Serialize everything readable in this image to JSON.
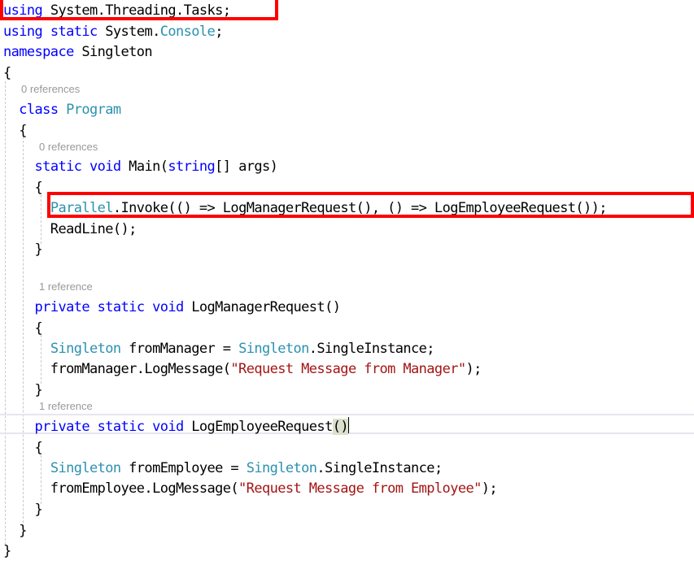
{
  "editor": {
    "lines": [
      {
        "tokens": [
          {
            "t": "using",
            "c": "kw"
          },
          {
            "t": " System.Threading.Tasks;",
            "c": ""
          }
        ]
      },
      {
        "tokens": [
          {
            "t": "using",
            "c": "kw"
          },
          {
            "t": " ",
            "c": ""
          },
          {
            "t": "static",
            "c": "kw"
          },
          {
            "t": " System.",
            "c": ""
          },
          {
            "t": "Console",
            "c": "ty"
          },
          {
            "t": ";",
            "c": ""
          }
        ]
      },
      {
        "tokens": [
          {
            "t": "namespace",
            "c": "kw"
          },
          {
            "t": " Singleton",
            "c": ""
          }
        ]
      },
      {
        "tokens": [
          {
            "t": "{",
            "c": ""
          }
        ]
      },
      {
        "tokens": [
          {
            "t": "  ",
            "c": ""
          },
          {
            "t": "class",
            "c": "kw"
          },
          {
            "t": " ",
            "c": ""
          },
          {
            "t": "Program",
            "c": "ty"
          }
        ]
      },
      {
        "tokens": [
          {
            "t": "  {",
            "c": ""
          }
        ]
      },
      {
        "tokens": [
          {
            "t": "    ",
            "c": ""
          },
          {
            "t": "static",
            "c": "kw"
          },
          {
            "t": " ",
            "c": ""
          },
          {
            "t": "void",
            "c": "kw"
          },
          {
            "t": " Main(",
            "c": ""
          },
          {
            "t": "string",
            "c": "kw"
          },
          {
            "t": "[] args)",
            "c": ""
          }
        ]
      },
      {
        "tokens": [
          {
            "t": "    {",
            "c": ""
          }
        ]
      },
      {
        "tokens": [
          {
            "t": "      ",
            "c": ""
          },
          {
            "t": "Parallel",
            "c": "ty"
          },
          {
            "t": ".Invoke(() => LogManagerRequest(), () => LogEmployeeRequest());",
            "c": ""
          }
        ]
      },
      {
        "tokens": [
          {
            "t": "      ReadLine();",
            "c": ""
          }
        ]
      },
      {
        "tokens": [
          {
            "t": "    }",
            "c": ""
          }
        ]
      },
      {
        "tokens": [
          {
            "t": "    ",
            "c": ""
          },
          {
            "t": "private",
            "c": "kw"
          },
          {
            "t": " ",
            "c": ""
          },
          {
            "t": "static",
            "c": "kw"
          },
          {
            "t": " ",
            "c": ""
          },
          {
            "t": "void",
            "c": "kw"
          },
          {
            "t": " LogManagerRequest()",
            "c": ""
          }
        ]
      },
      {
        "tokens": [
          {
            "t": "    {",
            "c": ""
          }
        ]
      },
      {
        "tokens": [
          {
            "t": "      ",
            "c": ""
          },
          {
            "t": "Singleton",
            "c": "ty"
          },
          {
            "t": " fromManager = ",
            "c": ""
          },
          {
            "t": "Singleton",
            "c": "ty"
          },
          {
            "t": ".SingleInstance;",
            "c": ""
          }
        ]
      },
      {
        "tokens": [
          {
            "t": "      fromManager.LogMessage(",
            "c": ""
          },
          {
            "t": "\"Request Message from Manager\"",
            "c": "str"
          },
          {
            "t": ");",
            "c": ""
          }
        ]
      },
      {
        "tokens": [
          {
            "t": "    }",
            "c": ""
          }
        ]
      },
      {
        "tokens": [
          {
            "t": "    ",
            "c": ""
          },
          {
            "t": "private",
            "c": "kw"
          },
          {
            "t": " ",
            "c": ""
          },
          {
            "t": "static",
            "c": "kw"
          },
          {
            "t": " ",
            "c": ""
          },
          {
            "t": "void",
            "c": "kw"
          },
          {
            "t": " LogEmployeeRequest",
            "c": ""
          },
          {
            "t": "()",
            "c": "bh"
          }
        ]
      },
      {
        "tokens": [
          {
            "t": "    {",
            "c": ""
          }
        ]
      },
      {
        "tokens": [
          {
            "t": "      ",
            "c": ""
          },
          {
            "t": "Singleton",
            "c": "ty"
          },
          {
            "t": " fromEmployee = ",
            "c": ""
          },
          {
            "t": "Singleton",
            "c": "ty"
          },
          {
            "t": ".SingleInstance;",
            "c": ""
          }
        ]
      },
      {
        "tokens": [
          {
            "t": "      fromEmployee.LogMessage(",
            "c": ""
          },
          {
            "t": "\"Request Message from Employee\"",
            "c": "str"
          },
          {
            "t": ");",
            "c": ""
          }
        ]
      },
      {
        "tokens": [
          {
            "t": "    }",
            "c": ""
          }
        ]
      },
      {
        "tokens": [
          {
            "t": "  }",
            "c": ""
          }
        ]
      },
      {
        "tokens": [
          {
            "t": "}",
            "c": ""
          }
        ]
      }
    ],
    "codelens": [
      {
        "label": "0 references"
      },
      {
        "label": "0 references"
      },
      {
        "label": "1 reference"
      },
      {
        "label": "1 reference"
      }
    ]
  },
  "colors": {
    "keyword": "#0000ff",
    "type": "#2b91af",
    "string": "#a31515",
    "highlight_box": "#ff0000"
  }
}
